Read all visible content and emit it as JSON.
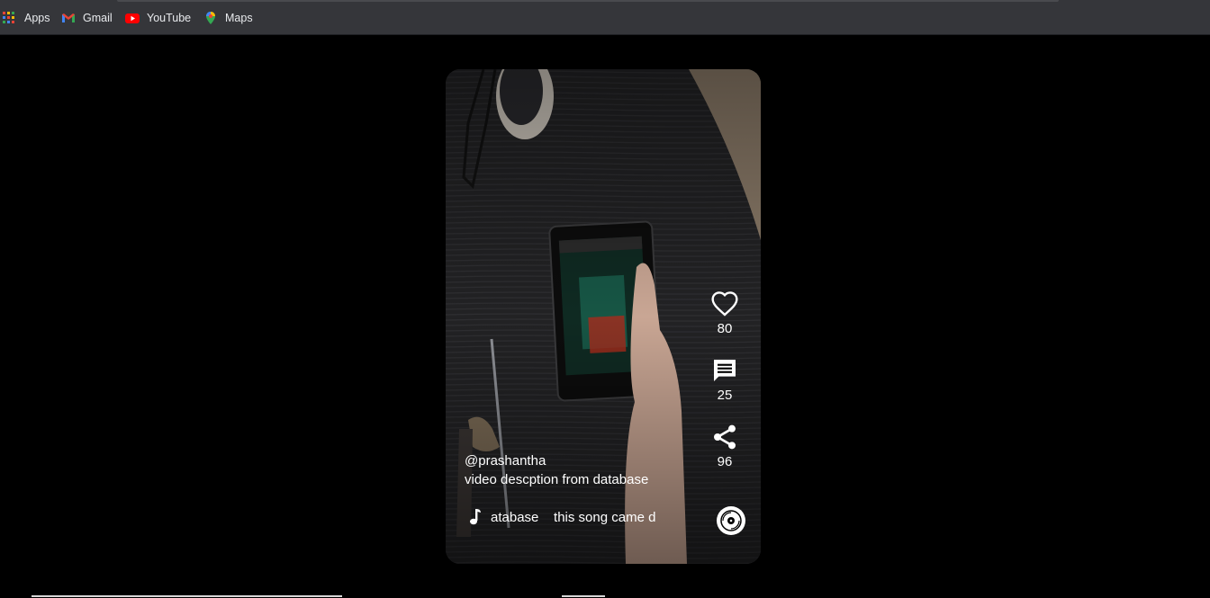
{
  "bookmarks": [
    {
      "label": "Apps",
      "icon": "apps-grid-icon"
    },
    {
      "label": "Gmail",
      "icon": "gmail-icon"
    },
    {
      "label": "YouTube",
      "icon": "youtube-icon"
    },
    {
      "label": "Maps",
      "icon": "maps-icon"
    }
  ],
  "video": {
    "username": "@prashantha",
    "description": "video descption from database",
    "song_text": "atabase    this song came d"
  },
  "actions": {
    "likes": "80",
    "comments": "25",
    "shares": "96"
  },
  "colors": {
    "page_background": "#000000",
    "bookmark_bar": "#35363a",
    "icon_color": "#ffffff"
  }
}
